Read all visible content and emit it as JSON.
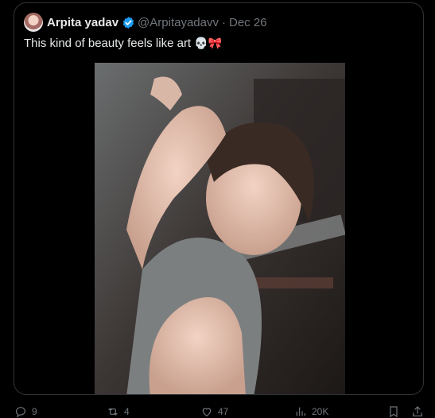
{
  "tweet": {
    "author_name": "Arpita yadav",
    "handle": "@Arpitayadavv",
    "separator": "·",
    "date": "Dec 26",
    "text": "This kind of beauty feels like art",
    "emojis": "💀🎀",
    "verified": true
  },
  "actions": {
    "reply_count": "9",
    "repost_count": "4",
    "like_count": "47",
    "views_count": "20K"
  },
  "colors": {
    "background": "#000000",
    "border": "#2f3336",
    "text_primary": "#e7e9ea",
    "text_secondary": "#71767b",
    "verified_blue": "#1d9bf0"
  }
}
